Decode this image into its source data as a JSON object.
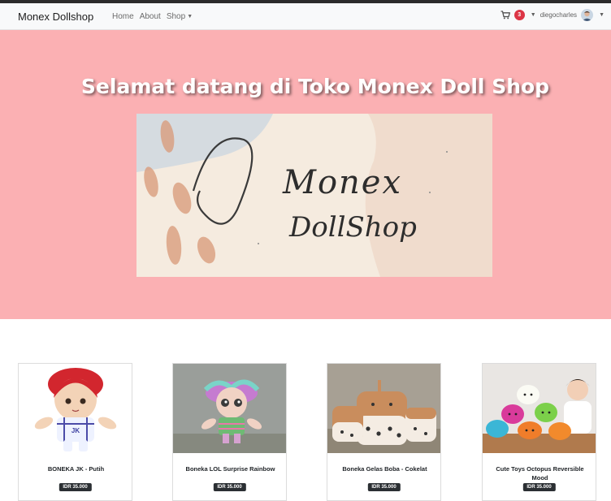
{
  "navbar": {
    "brand": "Monex Dollshop",
    "links": [
      {
        "label": "Home"
      },
      {
        "label": "About"
      },
      {
        "label": "Shop"
      }
    ],
    "cart_count": "3",
    "username": "diegocharles",
    "icons": [
      "cart-icon",
      "caret-down-icon",
      "avatar"
    ]
  },
  "hero": {
    "title": "Selamat datang di Toko Monex Doll Shop",
    "banner_logo": "Monex",
    "banner_sub": "DollShop",
    "background": "#fbb0b3"
  },
  "products": [
    {
      "name": "BONEKA JK - Putih",
      "price": "IDR 35.000"
    },
    {
      "name": "Boneka LOL Surprise Rainbow",
      "price": "IDR 35.000"
    },
    {
      "name": "Boneka Gelas Boba - Cokelat",
      "price": "IDR 35.000"
    },
    {
      "name": "Cute Toys Octopus Reversible Mood",
      "price": "IDR 35.000"
    }
  ],
  "colors": {
    "navbar_bg": "#f8f9fa",
    "badge": "#dc3545",
    "price_tag": "#2b2f33"
  }
}
